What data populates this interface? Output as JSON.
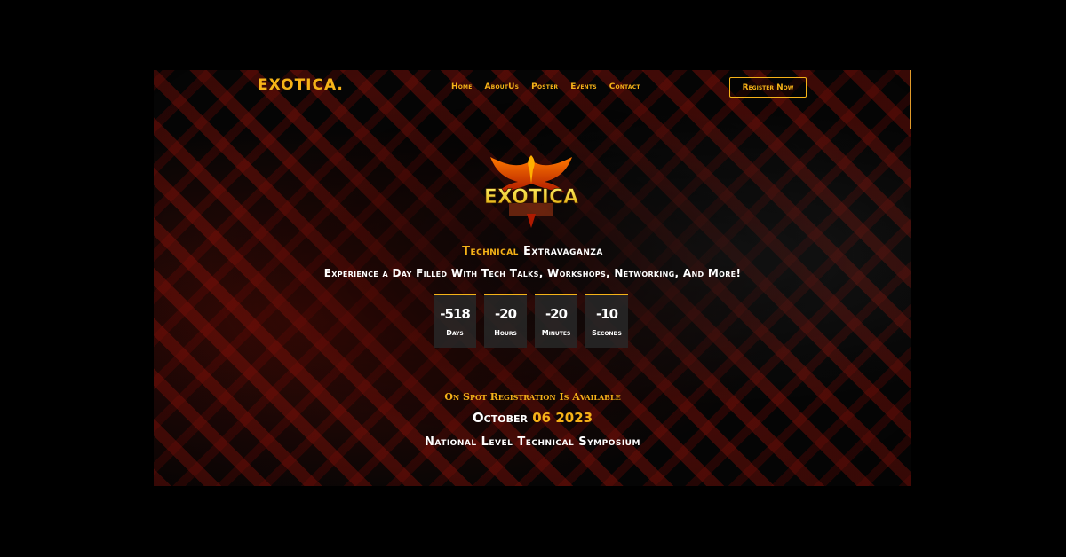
{
  "header": {
    "brand": "EXOTICA.",
    "nav": [
      {
        "label": "Home"
      },
      {
        "label": "AboutUs"
      },
      {
        "label": "Poster"
      },
      {
        "label": "Events"
      },
      {
        "label": "Contact"
      }
    ],
    "register_label": "Register Now"
  },
  "hero": {
    "logo_text": "EXOTICA",
    "tagline_part1": "Technical",
    "tagline_part2": "Extravaganza",
    "subline": "Experience a Day Filled With Tech Talks, Workshops, Networking, And More!",
    "countdown": [
      {
        "value": "-518",
        "label": "Days"
      },
      {
        "value": "-20",
        "label": "Hours"
      },
      {
        "value": "-20",
        "label": "Minutes"
      },
      {
        "value": "-10",
        "label": "Seconds"
      }
    ],
    "onspot": "On Spot Registration Is Available",
    "date_month": "October",
    "date_num": "06 2023",
    "national": "National Level Technical Symposium"
  },
  "colors": {
    "accent": "#f5b318",
    "background": "#000000"
  }
}
